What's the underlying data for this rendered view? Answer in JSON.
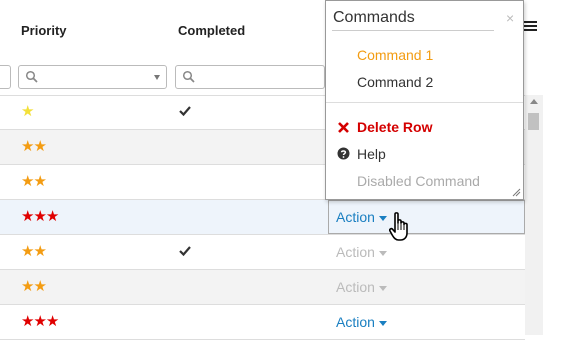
{
  "header": {
    "columns": [
      {
        "label": "Priority"
      },
      {
        "label": "Completed"
      }
    ]
  },
  "filter": {
    "search_icon": "search-icon",
    "dropdown_icon": "chevron-down-icon"
  },
  "rows": [
    {
      "stars": "★",
      "star_color": "yellow",
      "completed": true,
      "action": "",
      "row_style": "plain"
    },
    {
      "stars": "★★",
      "star_color": "orange",
      "completed": false,
      "action": "",
      "row_style": "alt"
    },
    {
      "stars": "★★",
      "star_color": "orange",
      "completed": false,
      "action": "",
      "row_style": "plain"
    },
    {
      "stars": "★★★",
      "star_color": "red",
      "completed": false,
      "action": "Action",
      "row_style": "sel",
      "action_state": "active"
    },
    {
      "stars": "★★",
      "star_color": "orange",
      "completed": true,
      "action": "Action",
      "row_style": "plain",
      "action_state": "dim"
    },
    {
      "stars": "★★",
      "star_color": "orange",
      "completed": false,
      "action": "Action",
      "row_style": "alt",
      "action_state": "dim"
    },
    {
      "stars": "★★★",
      "star_color": "red",
      "completed": false,
      "action": "Action",
      "row_style": "plain",
      "action_state": "active"
    }
  ],
  "popup": {
    "title": "Commands",
    "close_label": "×",
    "items": {
      "command1": "Command 1",
      "command2": "Command 2",
      "delete_row": "Delete Row",
      "delete_icon": "✖",
      "help": "Help",
      "disabled": "Disabled Command"
    }
  },
  "colors": {
    "accent": "#1a7fc1",
    "highlight_item": "#f39c12",
    "danger": "#d40000"
  }
}
